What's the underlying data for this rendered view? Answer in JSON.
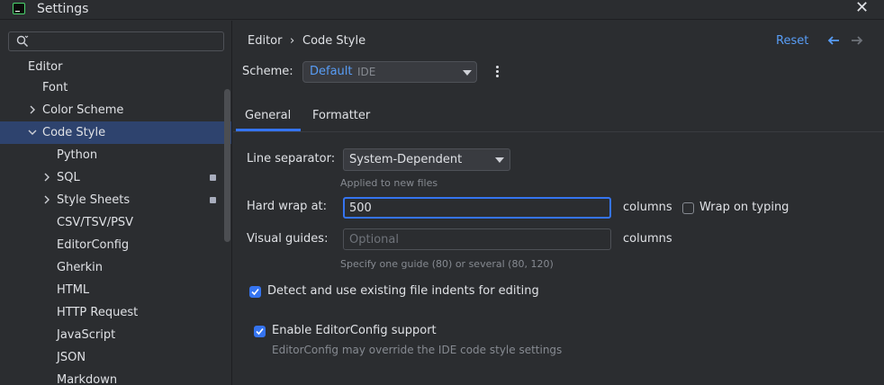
{
  "window": {
    "title": "Settings"
  },
  "sidebar": {
    "search": {
      "value": "",
      "placeholder": ""
    },
    "section_title": "Editor",
    "items": [
      {
        "label": "Font"
      },
      {
        "label": "Color Scheme"
      },
      {
        "label": "Code Style"
      },
      {
        "label": "Python"
      },
      {
        "label": "SQL"
      },
      {
        "label": "Style Sheets"
      },
      {
        "label": "CSV/TSV/PSV"
      },
      {
        "label": "EditorConfig"
      },
      {
        "label": "Gherkin"
      },
      {
        "label": "HTML"
      },
      {
        "label": "HTTP Request"
      },
      {
        "label": "JavaScript"
      },
      {
        "label": "JSON"
      },
      {
        "label": "Markdown"
      }
    ]
  },
  "breadcrumb": {
    "parent": "Editor",
    "separator": "›",
    "current": "Code Style"
  },
  "header": {
    "reset_label": "Reset"
  },
  "scheme": {
    "label": "Scheme:",
    "name": "Default",
    "scope": "IDE"
  },
  "tabs": [
    {
      "label": "General"
    },
    {
      "label": "Formatter"
    }
  ],
  "general": {
    "line_separator": {
      "label": "Line separator:",
      "value": "System-Dependent",
      "hint": "Applied to new files"
    },
    "hard_wrap": {
      "label": "Hard wrap at:",
      "value": "500",
      "unit": "columns"
    },
    "wrap_on_typing": {
      "label": "Wrap on typing",
      "checked": false
    },
    "visual_guides": {
      "label": "Visual guides:",
      "placeholder": "Optional",
      "unit": "columns",
      "hint": "Specify one guide (80) or several (80, 120)"
    },
    "detect_indents": {
      "label": "Detect and use existing file indents for editing",
      "checked": true
    },
    "editorconfig": {
      "label": "Enable EditorConfig support",
      "checked": true,
      "hint": "EditorConfig may override the IDE code style settings"
    }
  },
  "colors": {
    "accent": "#3574f0",
    "link": "#589df6",
    "selection": "#2e436e",
    "background": "#2b2d30"
  }
}
